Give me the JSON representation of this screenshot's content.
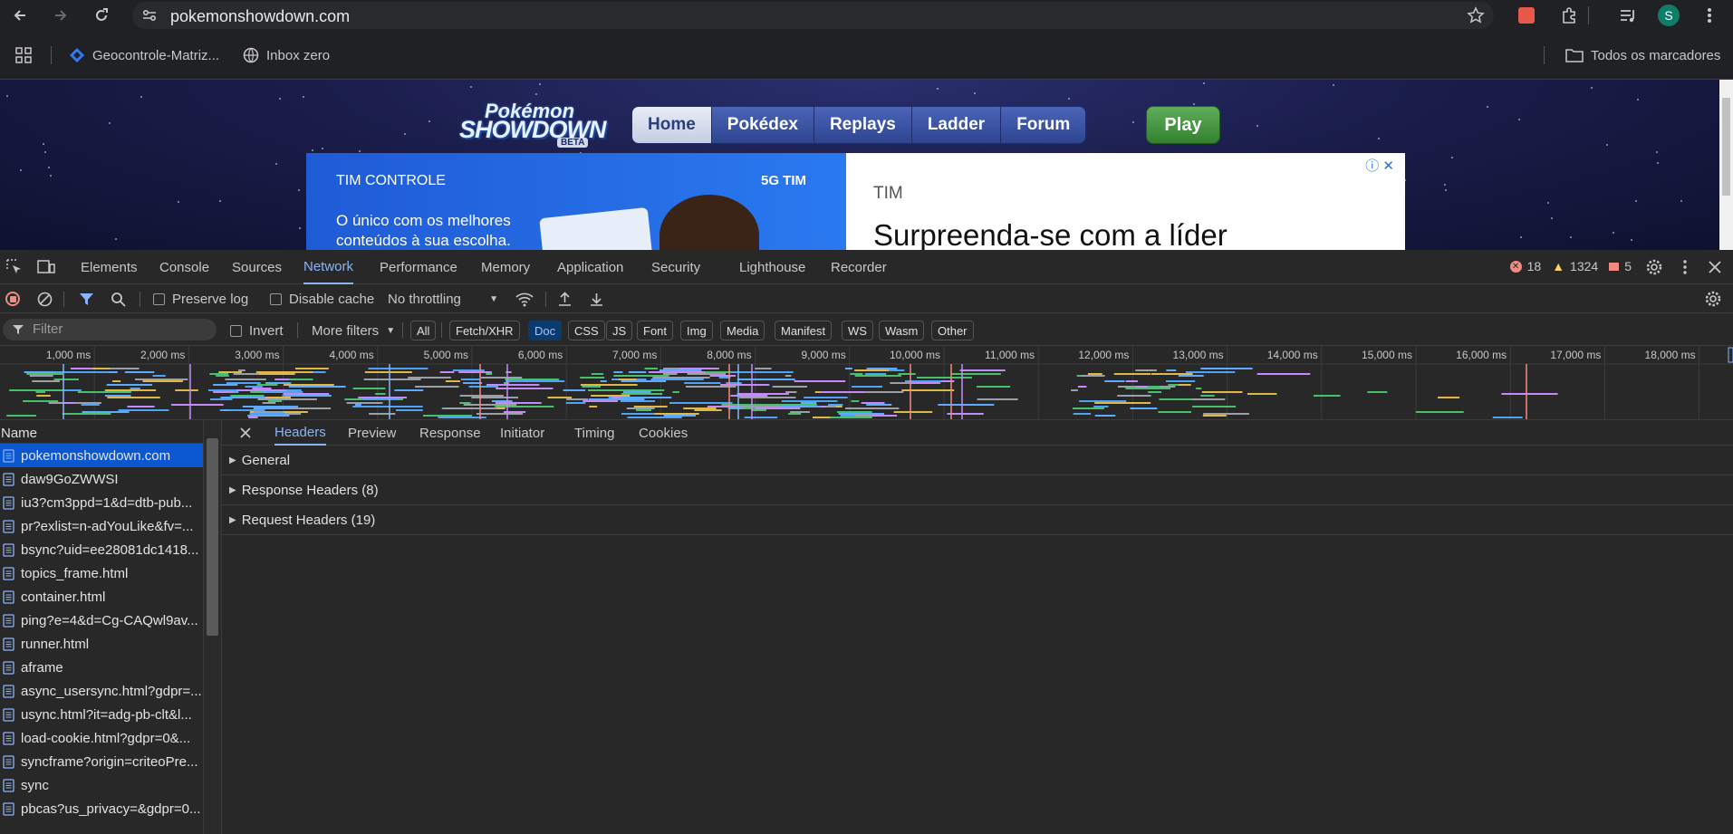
{
  "browser": {
    "url": "pokemonshowdown.com",
    "bookmarks": [
      {
        "label": "Geocontrole-Matriz..."
      },
      {
        "label": "Inbox zero"
      }
    ],
    "all_bookmarks_label": "Todos os marcadores",
    "profile_initial": "S"
  },
  "page": {
    "logo": {
      "line1": "Pokémon",
      "line2": "SHOWDOWN",
      "badge": "BETA"
    },
    "nav": [
      "Home",
      "Pokédex",
      "Replays",
      "Ladder",
      "Forum"
    ],
    "play_label": "Play",
    "ad": {
      "brand": "TIM CONTROLE",
      "tag": "5G TIM",
      "copy_line1": "O único com os melhores",
      "copy_line2": "conteúdos à sua escolha.",
      "sponsor": "TIM",
      "headline": "Surpreenda-se com a líder"
    }
  },
  "devtools": {
    "tabs": [
      "Elements",
      "Console",
      "Sources",
      "Network",
      "Performance",
      "Memory",
      "Application",
      "Security",
      "Lighthouse",
      "Recorder"
    ],
    "active_tab": "Network",
    "errors": "18",
    "warnings": "1324",
    "issues": "5",
    "toolbar": {
      "preserve_log": "Preserve log",
      "disable_cache": "Disable cache",
      "throttling": "No throttling"
    },
    "filter": {
      "placeholder": "Filter",
      "invert": "Invert",
      "more_filters": "More filters",
      "types": [
        "All",
        "Fetch/XHR",
        "Doc",
        "CSS",
        "JS",
        "Font",
        "Img",
        "Media",
        "Manifest",
        "WS",
        "Wasm",
        "Other"
      ],
      "active_type": "Doc"
    },
    "timeline_ticks": [
      "1,000 ms",
      "2,000 ms",
      "3,000 ms",
      "4,000 ms",
      "5,000 ms",
      "6,000 ms",
      "7,000 ms",
      "8,000 ms",
      "9,000 ms",
      "10,000 ms",
      "11,000 ms",
      "12,000 ms",
      "13,000 ms",
      "14,000 ms",
      "15,000 ms",
      "16,000 ms",
      "17,000 ms",
      "18,000 ms"
    ],
    "name_header": "Name",
    "requests": [
      "pokemonshowdown.com",
      "daw9GoZWWSI",
      "iu3?cm3ppd=1&d=dtb-pub...",
      "pr?exlist=n-adYouLike&fv=...",
      "bsync?uid=ee28081dc1418...",
      "topics_frame.html",
      "container.html",
      "ping?e=4&d=Cg-CAQwl9av...",
      "runner.html",
      "aframe",
      "async_usersync.html?gdpr=...",
      "usync.html?it=adg-pb-clt&l...",
      "load-cookie.html?gdpr=0&...",
      "syncframe?origin=criteoPre...",
      "sync",
      "pbcas?us_privacy=&gdpr=0..."
    ],
    "detail_tabs": [
      "Headers",
      "Preview",
      "Response",
      "Initiator",
      "Timing",
      "Cookies"
    ],
    "sections": [
      "General",
      "Response Headers (8)",
      "Request Headers (19)"
    ]
  }
}
